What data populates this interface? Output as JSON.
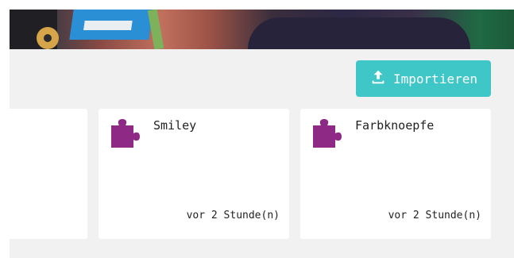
{
  "header": {
    "import_label": "Importieren"
  },
  "projects": [
    {
      "title": "",
      "time": ""
    },
    {
      "title": "Smiley",
      "time": "vor 2 Stunde(n)"
    },
    {
      "title": "Farbknoepfe",
      "time": "vor 2 Stunde(n)"
    }
  ],
  "colors": {
    "accent": "#3fc7c7",
    "puzzle": "#8e2a86",
    "background": "#f1f1f1",
    "card": "#ffffff"
  },
  "icons": {
    "import": "upload-icon",
    "project": "puzzle-icon"
  }
}
